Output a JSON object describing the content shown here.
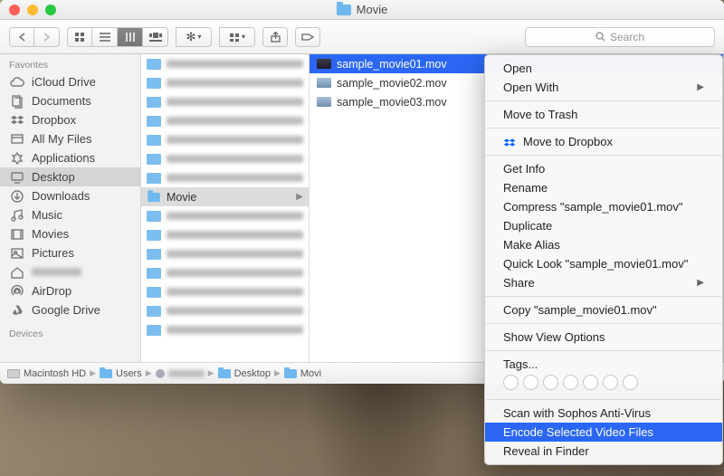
{
  "window": {
    "title": "Movie"
  },
  "toolbar": {
    "search_placeholder": "Search"
  },
  "sidebar": {
    "header": "Favorites",
    "header2": "Devices",
    "items": [
      {
        "label": "iCloud Drive"
      },
      {
        "label": "Documents"
      },
      {
        "label": "Dropbox"
      },
      {
        "label": "All My Files"
      },
      {
        "label": "Applications"
      },
      {
        "label": "Desktop"
      },
      {
        "label": "Downloads"
      },
      {
        "label": "Music"
      },
      {
        "label": "Movies"
      },
      {
        "label": "Pictures"
      },
      {
        "label": ""
      },
      {
        "label": "AirDrop"
      },
      {
        "label": "Google Drive"
      }
    ],
    "selected_index": 5
  },
  "col1": {
    "selected_label": "Movie"
  },
  "files": [
    {
      "name": "sample_movie01.mov",
      "selected": true
    },
    {
      "name": "sample_movie02.mov",
      "selected": false
    },
    {
      "name": "sample_movie03.mov",
      "selected": false
    }
  ],
  "path": {
    "root": "Macintosh HD",
    "users": "Users",
    "desktop": "Desktop",
    "current": "Movi"
  },
  "context_menu": {
    "open": "Open",
    "open_with": "Open With",
    "trash": "Move to Trash",
    "dropbox": "Move to Dropbox",
    "get_info": "Get Info",
    "rename": "Rename",
    "compress": "Compress \"sample_movie01.mov\"",
    "duplicate": "Duplicate",
    "alias": "Make Alias",
    "quicklook": "Quick Look \"sample_movie01.mov\"",
    "share": "Share",
    "copy": "Copy \"sample_movie01.mov\"",
    "view_opts": "Show View Options",
    "tags": "Tags...",
    "scan": "Scan with Sophos Anti-Virus",
    "encode": "Encode Selected Video Files",
    "reveal": "Reveal in Finder"
  }
}
